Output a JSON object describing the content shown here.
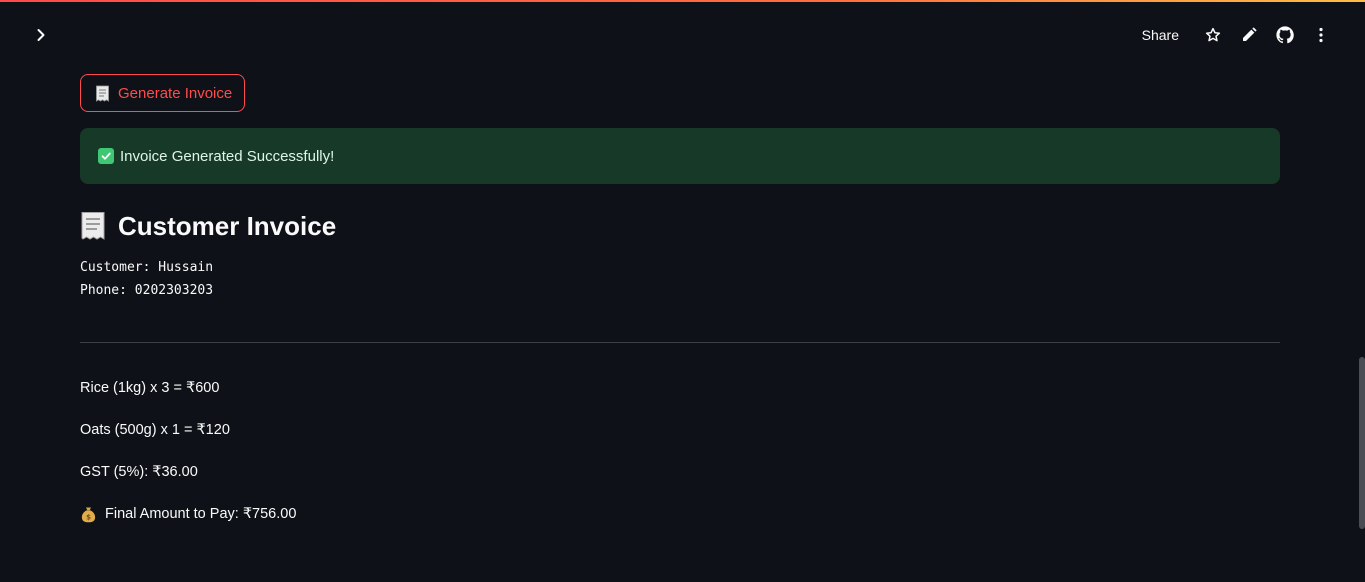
{
  "header": {
    "share_label": "Share",
    "icons": [
      "chevron-right-icon",
      "star-icon",
      "pencil-icon",
      "github-icon",
      "more-vertical-icon"
    ]
  },
  "actions": {
    "generate_label": "Generate Invoice"
  },
  "alert": {
    "message": "Invoice Generated Successfully!"
  },
  "invoice": {
    "title": "Customer Invoice",
    "customer_line": "Customer: Hussain",
    "phone_line": "Phone: 0202303203",
    "items": [
      "Rice (1kg) x 3 = ₹600",
      "Oats (500g) x 1 = ₹120"
    ],
    "gst_line": "GST (5%): ₹36.00",
    "final_line": "Final Amount to Pay: ₹756.00"
  },
  "colors": {
    "background": "#0e1117",
    "accent": "#ff4b4b",
    "success_bg": "#173928",
    "success_check": "#3fc774"
  }
}
